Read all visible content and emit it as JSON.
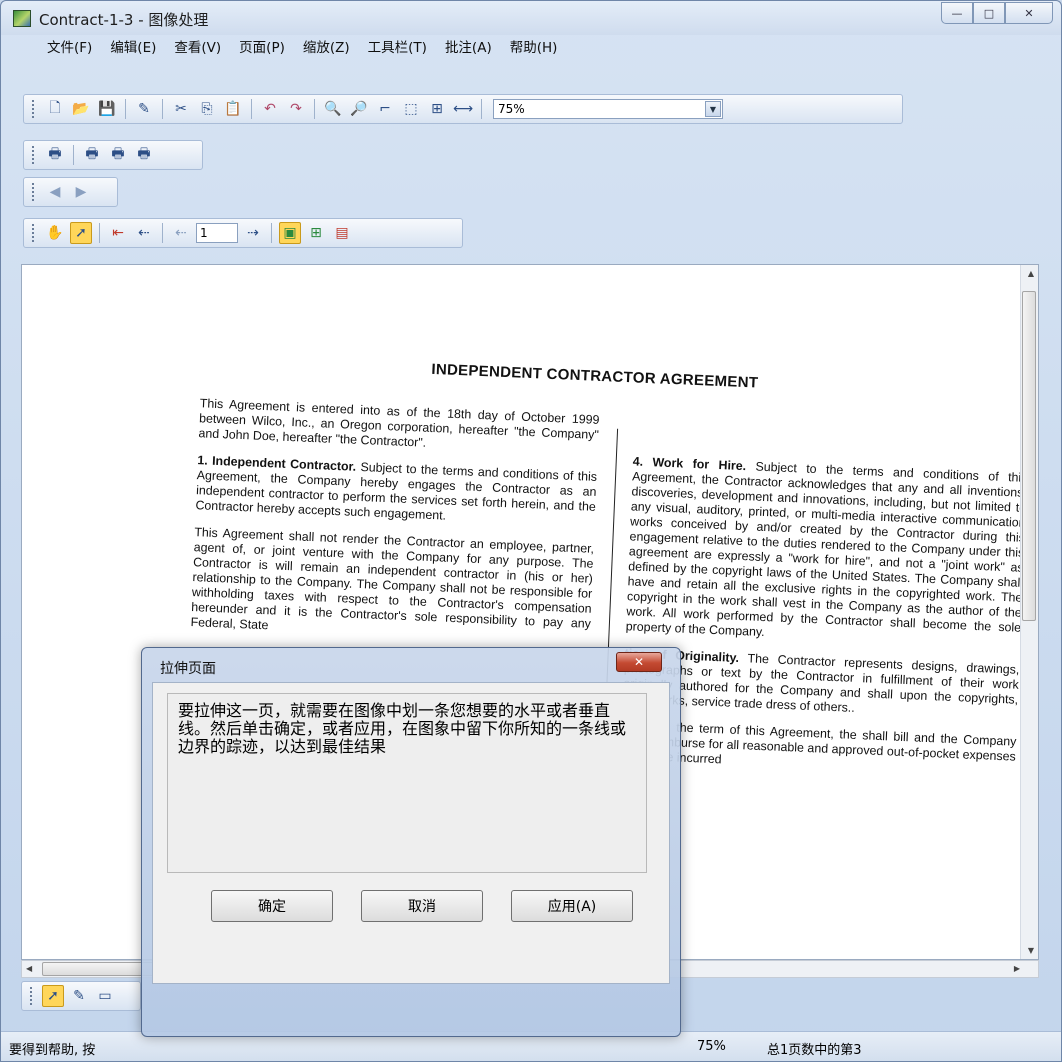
{
  "window": {
    "title": "Contract-1-3 - 图像处理"
  },
  "menu": [
    "文件(F)",
    "编辑(E)",
    "查看(V)",
    "页面(P)",
    "缩放(Z)",
    "工具栏(T)",
    "批注(A)",
    "帮助(H)"
  ],
  "toolbar": {
    "zoom_value": "75%",
    "page_number": "1"
  },
  "document": {
    "title": "INDEPENDENT CONTRACTOR AGREEMENT",
    "left_p1": "This Agreement is entered into as of the 18th day of October 1999 between Wilco, Inc., an Oregon corporation, hereafter \"the Company\" and John Doe, hereafter \"the Contractor\".",
    "left_p2_head": "1. Independent Contractor.",
    "left_p2": " Subject to the terms and conditions of this Agreement, the Company hereby engages the Contractor as an independent contractor to perform the services set forth herein, and the Contractor hereby accepts such engagement.",
    "left_p3": "This Agreement shall not render the Contractor an employee, partner, agent of, or joint venture with the Company for any purpose. The Contractor is will remain an independent contractor in (his or her) relationship to the Company. The Company shall not be responsible for withholding taxes with respect to the Contractor's compensation hereunder and it is the Contractor's sole responsibility to pay any Federal, State",
    "right_p1_head": "4. Work for Hire.",
    "right_p1": " Subject to the terms and conditions of this Agreement, the Contractor acknowledges that any and all inventions, discoveries, development and innovations, including, but not limited to any visual, auditory, printed, or multi-media interactive communication works conceived by and/or created by the Contractor during this engagement relative to the duties rendered to the Company under this agreement are expressly a \"work for hire\", and not a \"joint work\" as defined by the copyright laws of the United States. The Company shall have and retain all the exclusive rights in the copyrighted work. The copyright in the work shall vest in the Company as the author of the work. All work performed by the Contractor shall become the sole property of the Company.",
    "right_p2_head": "ties of Originality.",
    "right_p2": " The Contractor represents designs, drawings, photographs or text by the Contractor in fulfillment of their work originally authored for the Company and shall upon the copyrights, trademarks, service trade dress of others..",
    "right_p3_head": "s",
    "right_p3": " During the term of this Agreement, the shall bill and the Company shall reimburse for all reasonable and approved out-of-pocket expenses which are incurred"
  },
  "dialog": {
    "title": "拉伸页面",
    "message": "要拉伸这一页，就需要在图像中划一条您想要的水平或者垂直线。然后单击确定，或者应用，在图象中留下你所知的一条线或边界的踪迹，以达到最佳结果",
    "ok_label": "确定",
    "cancel_label": "取消",
    "apply_label": "应用(A)"
  },
  "status": {
    "help_text": "要得到帮助, 按",
    "zoom": "75%",
    "page_info": "总1页数中的第3"
  }
}
